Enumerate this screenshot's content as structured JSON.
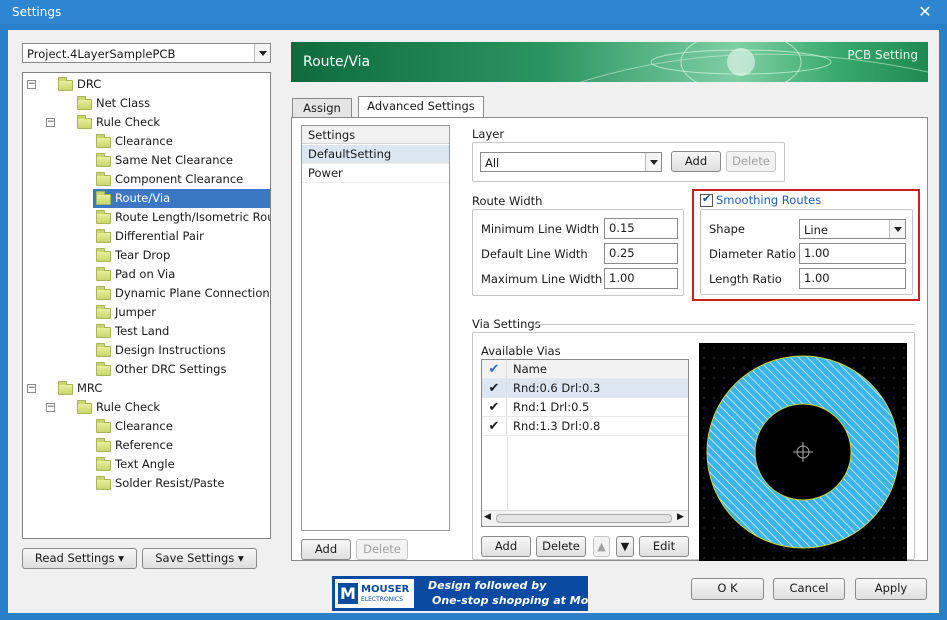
{
  "window": {
    "title": "Settings"
  },
  "project_select": "Project.4LayerSamplePCB",
  "tree": [
    {
      "label": "DRC",
      "level": 0,
      "expander": "−",
      "selected": false
    },
    {
      "label": "Net Class",
      "level": 1,
      "expander": "",
      "selected": false
    },
    {
      "label": "Rule Check",
      "level": 1,
      "expander": "−",
      "selected": false
    },
    {
      "label": "Clearance",
      "level": 2,
      "expander": "",
      "selected": false
    },
    {
      "label": "Same Net Clearance",
      "level": 2,
      "expander": "",
      "selected": false
    },
    {
      "label": "Component Clearance",
      "level": 2,
      "expander": "",
      "selected": false
    },
    {
      "label": "Route/Via",
      "level": 2,
      "expander": "",
      "selected": true
    },
    {
      "label": "Route Length/Isometric Routing",
      "level": 2,
      "expander": "",
      "selected": false
    },
    {
      "label": "Differential Pair",
      "level": 2,
      "expander": "",
      "selected": false
    },
    {
      "label": "Tear Drop",
      "level": 2,
      "expander": "",
      "selected": false
    },
    {
      "label": "Pad on Via",
      "level": 2,
      "expander": "",
      "selected": false
    },
    {
      "label": "Dynamic Plane Connection",
      "level": 2,
      "expander": "",
      "selected": false
    },
    {
      "label": "Jumper",
      "level": 2,
      "expander": "",
      "selected": false
    },
    {
      "label": "Test Land",
      "level": 2,
      "expander": "",
      "selected": false
    },
    {
      "label": "Design Instructions",
      "level": 2,
      "expander": "",
      "selected": false
    },
    {
      "label": "Other DRC Settings",
      "level": 2,
      "expander": "",
      "selected": false
    },
    {
      "label": "MRC",
      "level": 0,
      "expander": "−",
      "selected": false
    },
    {
      "label": "Rule Check",
      "level": 1,
      "expander": "−",
      "selected": false
    },
    {
      "label": "Clearance",
      "level": 2,
      "expander": "",
      "selected": false
    },
    {
      "label": "Reference",
      "level": 2,
      "expander": "",
      "selected": false
    },
    {
      "label": "Text Angle",
      "level": 2,
      "expander": "",
      "selected": false
    },
    {
      "label": "Solder Resist/Paste",
      "level": 2,
      "expander": "",
      "selected": false
    }
  ],
  "bottom_left": {
    "read": "Read Settings",
    "save": "Save Settings"
  },
  "banner": {
    "title": "Route/Via",
    "right": "PCB Setting"
  },
  "tabs": [
    "Assign",
    "Advanced Settings"
  ],
  "settings_list": {
    "header": "Settings",
    "items": [
      "DefaultSetting",
      "Power"
    ],
    "add": "Add",
    "delete": "Delete"
  },
  "layer": {
    "group": "Layer",
    "value": "All",
    "add": "Add",
    "delete": "Delete"
  },
  "route_width": {
    "group": "Route Width",
    "min_label": "Minimum Line Width",
    "min_value": "0.15",
    "def_label": "Default Line Width",
    "def_value": "0.25",
    "max_label": "Maximum Line Width",
    "max_value": "1.00"
  },
  "smoothing": {
    "label": "Smoothing Routes",
    "checked": true,
    "shape_label": "Shape",
    "shape_value": "Line",
    "diameter_label": "Diameter Ratio",
    "diameter_value": "1.00",
    "length_label": "Length Ratio",
    "length_value": "1.00"
  },
  "via": {
    "group": "Via Settings",
    "available": "Available Vias",
    "header": "Name",
    "rows": [
      "Rnd:0.6  Drl:0.3",
      "Rnd:1  Drl:0.5",
      "Rnd:1.3  Drl:0.8"
    ],
    "add": "Add",
    "delete": "Delete",
    "edit": "Edit"
  },
  "footer": {
    "ok": "O K",
    "cancel": "Cancel",
    "apply": "Apply"
  },
  "ad": {
    "logo": "MOUSER",
    "logo_sub": "ELECTRONICS",
    "line1": "Design followed by",
    "line2": "One-stop shopping at Mouser"
  },
  "colors": {
    "selection": "#3a78c4",
    "highlight_box": "#cc1f1f",
    "via_ring": "#3cb4e6"
  }
}
